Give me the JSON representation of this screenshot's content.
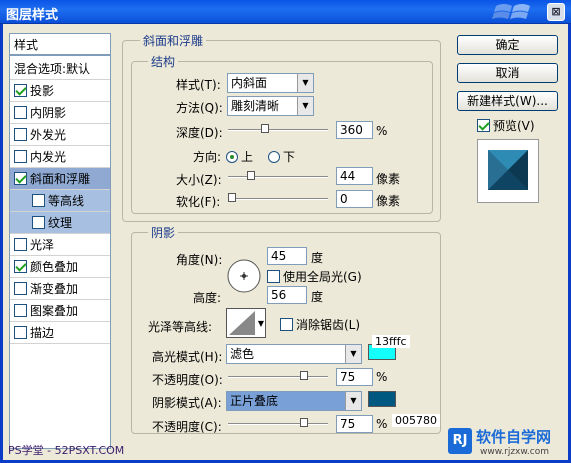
{
  "window": {
    "title": "图层样式",
    "close": "⊠"
  },
  "styles": {
    "header": "样式",
    "items": [
      {
        "label": "混合选项:默认",
        "checkbox": false,
        "checked": false,
        "sub": false,
        "selected": false
      },
      {
        "label": "投影",
        "checkbox": true,
        "checked": true,
        "sub": false,
        "selected": false
      },
      {
        "label": "内阴影",
        "checkbox": true,
        "checked": false,
        "sub": false,
        "selected": false
      },
      {
        "label": "外发光",
        "checkbox": true,
        "checked": false,
        "sub": false,
        "selected": false
      },
      {
        "label": "内发光",
        "checkbox": true,
        "checked": false,
        "sub": false,
        "selected": false
      },
      {
        "label": "斜面和浮雕",
        "checkbox": true,
        "checked": true,
        "sub": false,
        "selected": true
      },
      {
        "label": "等高线",
        "checkbox": true,
        "checked": false,
        "sub": true,
        "selected": false
      },
      {
        "label": "纹理",
        "checkbox": true,
        "checked": false,
        "sub": true,
        "selected": false
      },
      {
        "label": "光泽",
        "checkbox": true,
        "checked": false,
        "sub": false,
        "selected": false
      },
      {
        "label": "颜色叠加",
        "checkbox": true,
        "checked": true,
        "sub": false,
        "selected": false
      },
      {
        "label": "渐变叠加",
        "checkbox": true,
        "checked": false,
        "sub": false,
        "selected": false
      },
      {
        "label": "图案叠加",
        "checkbox": true,
        "checked": false,
        "sub": false,
        "selected": false
      },
      {
        "label": "描边",
        "checkbox": true,
        "checked": false,
        "sub": false,
        "selected": false
      }
    ]
  },
  "bevel": {
    "title": "斜面和浮雕",
    "structure": {
      "title": "结构",
      "style_label": "样式(T):",
      "style_value": "内斜面",
      "technique_label": "方法(Q):",
      "technique_value": "雕刻清晰",
      "depth_label": "深度(D):",
      "depth_value": "360",
      "depth_unit": "%",
      "depth_level": 0.34,
      "direction_label": "方向:",
      "dir_up": "上",
      "dir_down": "下",
      "size_label": "大小(Z):",
      "size_value": "44",
      "size_unit": "像素",
      "size_level": 0.2,
      "soften_label": "软化(F):",
      "soften_value": "0",
      "soften_unit": "像素",
      "soften_level": 0
    },
    "shading": {
      "title": "阴影",
      "angle_label": "角度(N):",
      "angle_value": "45",
      "angle_unit": "度",
      "global_label": "使用全局光(G)",
      "altitude_label": "高度:",
      "altitude_value": "56",
      "altitude_unit": "度",
      "gloss_label": "光泽等高线:",
      "antialias_label": "消除锯齿(L)",
      "highlight_label": "高光模式(H):",
      "highlight_value": "滤色",
      "highlight_color": "#13fffc",
      "highlight_hex": "13fffc",
      "hl_opacity_label": "不透明度(O):",
      "hl_opacity_value": "75",
      "hl_opacity_unit": "%",
      "hl_level": 0.75,
      "shadow_label": "阴影模式(A):",
      "shadow_value": "正片叠底",
      "shadow_color": "#005780",
      "shadow_hex": "005780",
      "sh_opacity_label": "不透明度(C):",
      "sh_opacity_value": "75",
      "sh_opacity_unit": "%",
      "sh_level": 0.75
    }
  },
  "buttons": {
    "ok": "确定",
    "cancel": "取消",
    "new_style": "新建样式(W)...",
    "preview": "预览(V)"
  },
  "watermark": {
    "left": "PS学堂 - 52PSXT.COM",
    "right_logo": "RJ",
    "right_text": "软件自学网",
    "right_url": "www.rjzxw.com"
  }
}
